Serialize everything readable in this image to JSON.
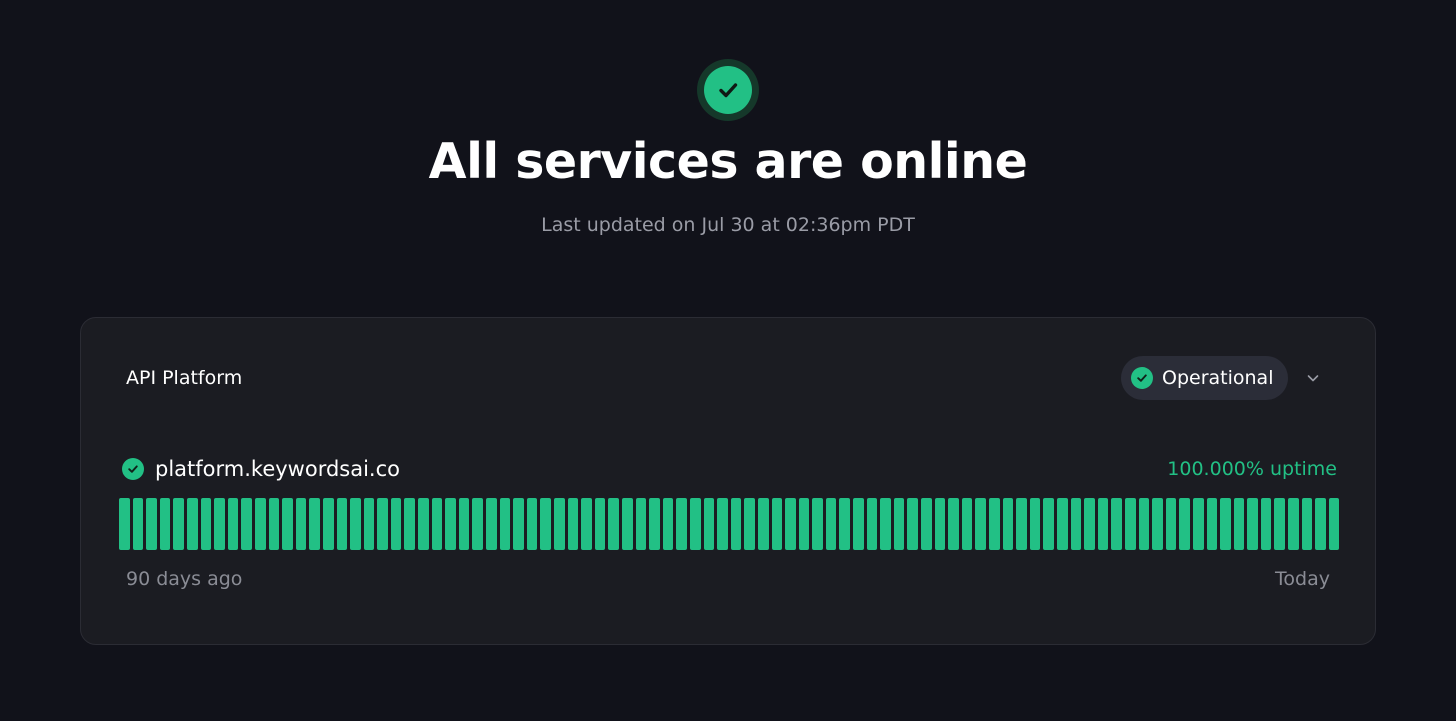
{
  "hero": {
    "icon": "check-circle-icon",
    "title": "All services are online",
    "last_updated": "Last updated on Jul 30 at 02:36pm PDT"
  },
  "colors": {
    "background": "#11121a",
    "card": "#1b1c22",
    "operational_green": "#22c085",
    "muted_text": "#9a9ca6"
  },
  "card": {
    "title": "API Platform",
    "status": {
      "label": "Operational",
      "icon": "check-circle-icon"
    },
    "expand_icon": "chevron-down-icon",
    "service": {
      "name": "platform.keywordsai.co",
      "icon": "check-circle-icon",
      "uptime": "100.000% uptime",
      "days": 90,
      "day_status": "operational",
      "range_start": "90 days ago",
      "range_end": "Today"
    }
  }
}
